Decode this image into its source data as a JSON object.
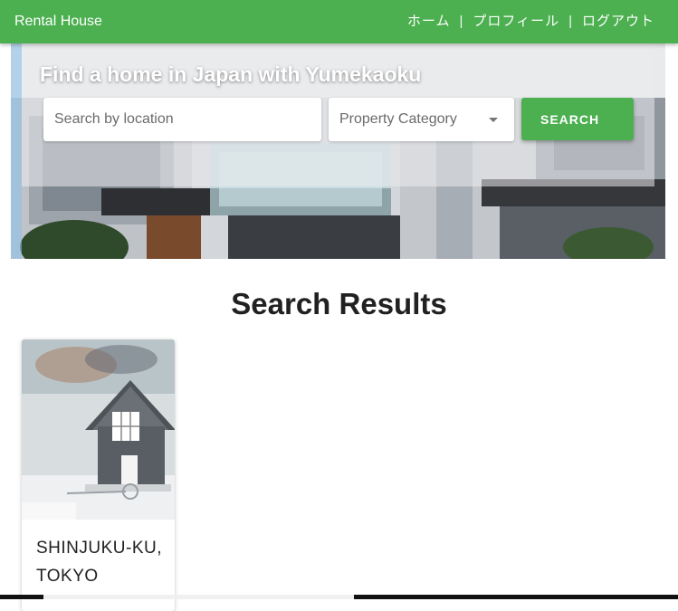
{
  "header": {
    "brand": "Rental House",
    "nav": {
      "home": "ホーム",
      "profile": "プロフィール",
      "logout": "ログアウト",
      "separator": "|"
    },
    "background_color": "#4caf50"
  },
  "hero": {
    "title": "Find a home in Japan with Yumekaoku",
    "search": {
      "placeholder": "Search by location",
      "value": ""
    },
    "category": {
      "selected": "Property Category",
      "icon": "dropdown-caret-icon"
    },
    "search_button_label": "SEARCH"
  },
  "results": {
    "heading": "Search Results",
    "items": [
      {
        "title": "SHINJUKU-KU, TOKYO",
        "image": "house-model-handshake-image"
      }
    ]
  }
}
